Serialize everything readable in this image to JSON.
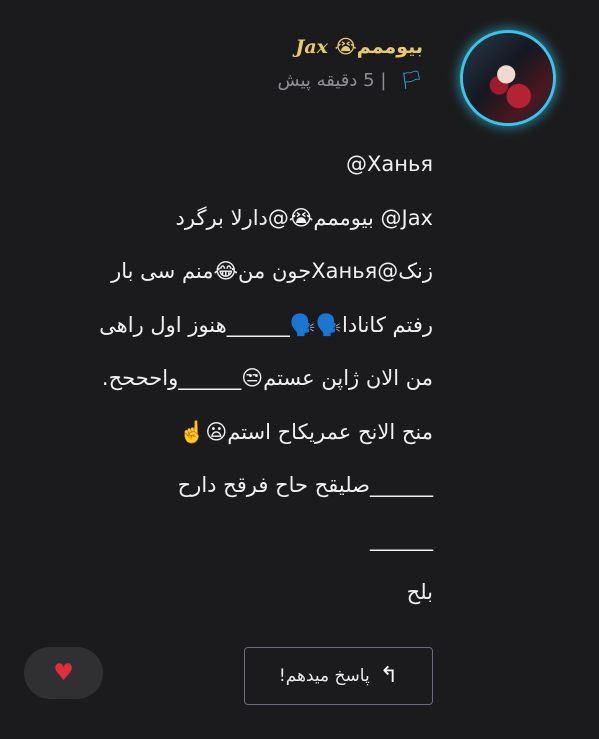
{
  "comment": {
    "author_persian": "بیوممم😭",
    "author_en": "Jax",
    "meta": "5 دقیقه پیش",
    "separator": "|",
    "flag_icon": "🏳",
    "lines": [
      "Ханья@",
      "Jax@ بیوممم😭@دارلا برگرد",
      "زنک@Ханьяجون من😂منم سی بار",
      "رفتم کانادا🗣️🗣️______هنوز اول راهی",
      "من الان ژاپن عستم😒______واحححح.",
      "منح الانح عمریکاح استم😦☝️",
      "______صلیقح حاح فرقح دارح",
      "______",
      "بلح"
    ]
  },
  "actions": {
    "reply_label": "پاسخ میدهم!",
    "reply_icon": "↰",
    "like_icon": "♥"
  },
  "colors": {
    "background": "#1b1b1d",
    "author": "#e8c96c",
    "accent": "#31b7dd",
    "like": "#e02d3c"
  }
}
